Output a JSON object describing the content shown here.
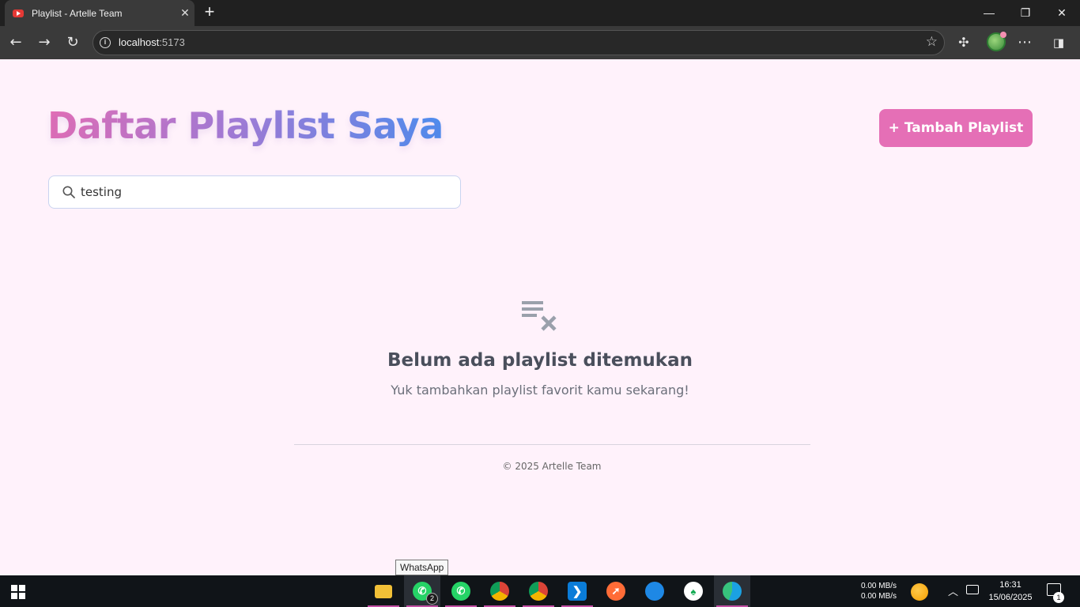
{
  "browser": {
    "tab_title": "Playlist - Artelle Team",
    "tab_close": "✕",
    "new_tab": "+",
    "url_host": "localhost",
    "url_port": ":5173",
    "window_controls": {
      "minimize": "—",
      "restore": "❐",
      "close": "✕"
    }
  },
  "page": {
    "title": "Daftar Playlist Saya",
    "add_button": "+ Tambah Playlist",
    "search": {
      "value": "testing",
      "placeholder": ""
    },
    "empty_title": "Belum ada playlist ditemukan",
    "empty_subtitle": "Yuk tambahkan playlist favorit kamu sekarang!",
    "footer": "© 2025 Artelle Team"
  },
  "tooltip": "WhatsApp",
  "taskbar": {
    "apps": [
      {
        "name": "file-explorer",
        "color": "#f2c037"
      },
      {
        "name": "whatsapp",
        "color": "#25d366",
        "badge": "2",
        "active": true
      },
      {
        "name": "whatsapp-2",
        "color": "#25d366"
      },
      {
        "name": "chrome",
        "color": "#db4437"
      },
      {
        "name": "chrome-2",
        "color": "#db4437"
      },
      {
        "name": "vscode",
        "color": "#0a7cd8"
      },
      {
        "name": "postman",
        "color": "#ff6c37"
      },
      {
        "name": "app-blue",
        "color": "#1e88e5"
      },
      {
        "name": "mongodb",
        "color": "#ffffff"
      },
      {
        "name": "edge",
        "color": "#1ba1e2"
      }
    ],
    "net_up": "0.00 MB/s",
    "net_down": "0.00 MB/s",
    "time": "16:31",
    "date": "15/06/2025",
    "notif_count": "1"
  },
  "colors": {
    "accent_pink": "#e56fb6",
    "accent_blue": "#4d8ff0",
    "page_bg": "#fff2fb"
  }
}
